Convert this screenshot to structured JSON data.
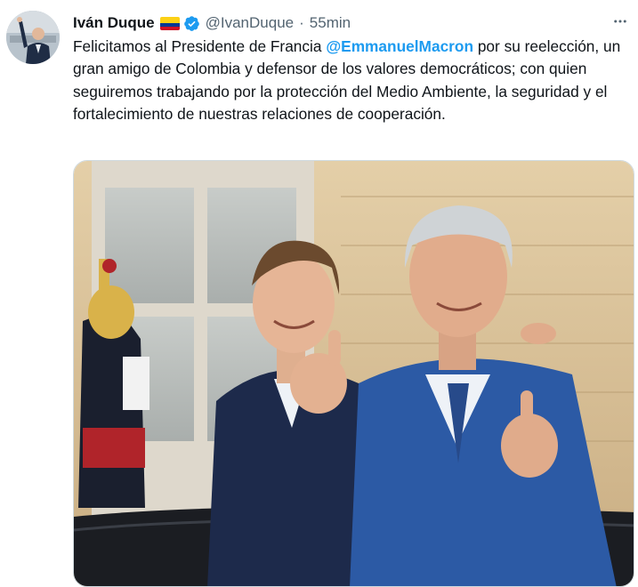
{
  "tweet": {
    "author_name": "Iván Duque",
    "handle": "@IvanDuque",
    "separator": "·",
    "timestamp": "55min",
    "more_icon": "more-horizontal-icon",
    "verified_icon": "verified-badge-icon",
    "flag_icon": "colombia-flag-icon",
    "text_before": "Felicitamos al Presidente de Francia ",
    "mention": "@EmmanuelMacron",
    "text_after": " por su reelección, un gran amigo de Colombia y defensor de los valores democráticos; con quien seguiremos trabajando por la protección del Medio Ambiente, la seguridad y el fortalecimiento de nuestras relaciones de cooperación."
  },
  "colors": {
    "link": "#1d9bf0",
    "verified": "#1d9bf0",
    "secondary_text": "#536471",
    "primary_text": "#0f1419"
  }
}
